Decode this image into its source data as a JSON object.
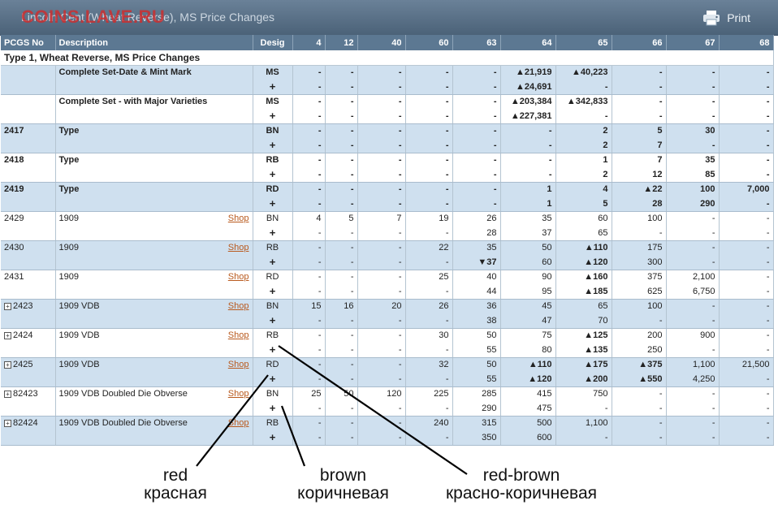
{
  "header": {
    "title": "Lincoln Cent (Wheat Reverse), MS    Price Changes",
    "watermark": "COINS.LAVE.RU",
    "print_label": "Print"
  },
  "table": {
    "columns": [
      "PCGS No",
      "Description",
      "Desig",
      "4",
      "12",
      "40",
      "60",
      "63",
      "64",
      "65",
      "66",
      "67",
      "68"
    ],
    "section_title": "Type 1, Wheat Reverse, MS    Price Changes",
    "shop_label": "Shop",
    "rows": [
      {
        "pcgs": "",
        "desc": "Complete Set-Date & Mint Mark",
        "desig": "MS",
        "bold": true,
        "expand": false,
        "shop": false,
        "v1": [
          "-",
          "-",
          "-",
          "-",
          "-",
          "▲21,919",
          "▲40,223",
          "-",
          "-",
          "-"
        ],
        "v2": [
          "-",
          "-",
          "-",
          "-",
          "-",
          "▲24,691",
          "-",
          "-",
          "-",
          "-"
        ]
      },
      {
        "pcgs": "",
        "desc": "Complete Set - with Major Varieties",
        "desig": "MS",
        "bold": true,
        "expand": false,
        "shop": false,
        "v1": [
          "-",
          "-",
          "-",
          "-",
          "-",
          "▲203,384",
          "▲342,833",
          "-",
          "-",
          "-"
        ],
        "v2": [
          "-",
          "-",
          "-",
          "-",
          "-",
          "▲227,381",
          "-",
          "-",
          "-",
          "-"
        ]
      },
      {
        "pcgs": "2417",
        "desc": "Type",
        "desig": "BN",
        "bold": true,
        "expand": false,
        "shop": false,
        "v1": [
          "-",
          "-",
          "-",
          "-",
          "-",
          "-",
          "2",
          "5",
          "30",
          "-"
        ],
        "v2": [
          "-",
          "-",
          "-",
          "-",
          "-",
          "-",
          "2",
          "7",
          "-",
          "-"
        ]
      },
      {
        "pcgs": "2418",
        "desc": "Type",
        "desig": "RB",
        "bold": true,
        "expand": false,
        "shop": false,
        "v1": [
          "-",
          "-",
          "-",
          "-",
          "-",
          "-",
          "1",
          "7",
          "35",
          "-"
        ],
        "v2": [
          "-",
          "-",
          "-",
          "-",
          "-",
          "-",
          "2",
          "12",
          "85",
          "-"
        ]
      },
      {
        "pcgs": "2419",
        "desc": "Type",
        "desig": "RD",
        "bold": true,
        "expand": false,
        "shop": false,
        "v1": [
          "-",
          "-",
          "-",
          "-",
          "-",
          "1",
          "4",
          "▲22",
          "100",
          "7,000"
        ],
        "v2": [
          "-",
          "-",
          "-",
          "-",
          "-",
          "1",
          "5",
          "28",
          "290",
          "-"
        ]
      },
      {
        "pcgs": "2429",
        "desc": "1909",
        "desig": "BN",
        "bold": false,
        "expand": false,
        "shop": true,
        "v1": [
          "4",
          "5",
          "7",
          "19",
          "26",
          "35",
          "60",
          "100",
          "-",
          "-"
        ],
        "v2": [
          "-",
          "-",
          "-",
          "-",
          "28",
          "37",
          "65",
          "-",
          "-",
          "-"
        ]
      },
      {
        "pcgs": "2430",
        "desc": "1909",
        "desig": "RB",
        "bold": false,
        "expand": false,
        "shop": true,
        "v1": [
          "-",
          "-",
          "-",
          "22",
          "35",
          "50",
          "▲110",
          "175",
          "-",
          "-"
        ],
        "v2": [
          "-",
          "-",
          "-",
          "-",
          "▼37",
          "60",
          "▲120",
          "300",
          "-",
          "-"
        ]
      },
      {
        "pcgs": "2431",
        "desc": "1909",
        "desig": "RD",
        "bold": false,
        "expand": false,
        "shop": true,
        "v1": [
          "-",
          "-",
          "-",
          "25",
          "40",
          "90",
          "▲160",
          "375",
          "2,100",
          "-"
        ],
        "v2": [
          "-",
          "-",
          "-",
          "-",
          "44",
          "95",
          "▲185",
          "625",
          "6,750",
          "-"
        ]
      },
      {
        "pcgs": "2423",
        "desc": "1909 VDB",
        "desig": "BN",
        "bold": false,
        "expand": true,
        "shop": true,
        "v1": [
          "15",
          "16",
          "20",
          "26",
          "36",
          "45",
          "65",
          "100",
          "-",
          "-"
        ],
        "v2": [
          "-",
          "-",
          "-",
          "-",
          "38",
          "47",
          "70",
          "-",
          "-",
          "-"
        ]
      },
      {
        "pcgs": "2424",
        "desc": "1909 VDB",
        "desig": "RB",
        "bold": false,
        "expand": true,
        "shop": true,
        "v1": [
          "-",
          "-",
          "-",
          "30",
          "50",
          "75",
          "▲125",
          "200",
          "900",
          "-"
        ],
        "v2": [
          "-",
          "-",
          "-",
          "-",
          "55",
          "80",
          "▲135",
          "250",
          "-",
          "-"
        ]
      },
      {
        "pcgs": "2425",
        "desc": "1909 VDB",
        "desig": "RD",
        "bold": false,
        "expand": true,
        "shop": true,
        "v1": [
          "-",
          "-",
          "-",
          "32",
          "50",
          "▲110",
          "▲175",
          "▲375",
          "1,100",
          "21,500"
        ],
        "v2": [
          "-",
          "-",
          "-",
          "-",
          "55",
          "▲120",
          "▲200",
          "▲550",
          "4,250",
          "-"
        ]
      },
      {
        "pcgs": "82423",
        "desc": "1909 VDB Doubled Die Obverse",
        "desig": "BN",
        "bold": false,
        "expand": true,
        "shop": true,
        "v1": [
          "25",
          "50",
          "120",
          "225",
          "285",
          "415",
          "750",
          "-",
          "-",
          "-"
        ],
        "v2": [
          "-",
          "-",
          "-",
          "-",
          "290",
          "475",
          "-",
          "-",
          "-",
          "-"
        ]
      },
      {
        "pcgs": "82424",
        "desc": "1909 VDB Doubled Die Obverse",
        "desig": "RB",
        "bold": false,
        "expand": true,
        "shop": true,
        "v1": [
          "-",
          "-",
          "-",
          "240",
          "315",
          "500",
          "1,100",
          "-",
          "-",
          "-"
        ],
        "v2": [
          "-",
          "-",
          "-",
          "-",
          "350",
          "600",
          "-",
          "-",
          "-",
          "-"
        ]
      }
    ]
  },
  "annotations": {
    "red_en": "red",
    "red_ru": "красная",
    "brown_en": "brown",
    "brown_ru": "коричневая",
    "redbrown_en": "red-brown",
    "redbrown_ru": "красно-коричневая"
  },
  "colors": {
    "header_bg": "#5c7892",
    "row_blue": "#cfe0ef",
    "up": "#0e8a16",
    "down": "#c41212",
    "shop": "#b95a1e",
    "watermark": "#d02c2c"
  }
}
